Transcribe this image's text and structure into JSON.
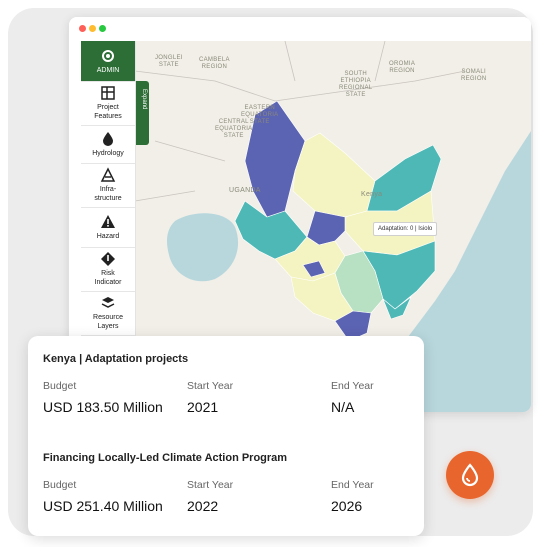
{
  "window_controls": {
    "close_color": "#ff5f57",
    "minimize_color": "#febc2e",
    "maximize_color": "#28c840"
  },
  "sidebar": {
    "items": [
      {
        "label": "ADMIN",
        "icon": "admin-gear-icon"
      },
      {
        "label": "Project\nFeatures",
        "icon": "project-features-icon"
      },
      {
        "label": "Hydrology",
        "icon": "droplet-icon"
      },
      {
        "label": "Infra-\nstructure",
        "icon": "infrastructure-icon"
      },
      {
        "label": "Hazard",
        "icon": "warning-icon"
      },
      {
        "label": "Risk\nIndicator",
        "icon": "risk-indicator-icon"
      },
      {
        "label": "Resource\nLayers",
        "icon": "resource-layers-icon"
      }
    ],
    "expand_label": "Expand"
  },
  "map": {
    "labels": [
      "JONGLEI\nSTATE",
      "CAMBELA\nREGION",
      "OROMIA\nREGION",
      "SOMALI\nREGION",
      "SOUTH\nETHIOPIA\nREGIONAL\nSTATE",
      "EASTERN\nEQUATORIA\nSTATE",
      "CENTRAL\nEQUATORIA\nSTATE",
      "UGANDA",
      "Kenya"
    ],
    "tooltip": "Adaptation: 0 | Isiolo",
    "colors": {
      "dark": "#5b63b3",
      "teal": "#4db8b6",
      "yellow": "#f4f4c2",
      "mint": "#b8e0c2",
      "water": "#b7d7dd"
    }
  },
  "card": {
    "project1": {
      "title": "Kenya | Adaptation projects",
      "budget_label": "Budget",
      "budget_value": "USD 183.50 Million",
      "start_label": "Start Year",
      "start_value": "2021",
      "end_label": "End Year",
      "end_value": "N/A"
    },
    "project2": {
      "title": "Financing Locally-Led Climate Action Program",
      "budget_label": "Budget",
      "budget_value": "USD 251.40 Million",
      "start_label": "Start Year",
      "start_value": "2022",
      "end_label": "End Year",
      "end_value": "2026"
    }
  },
  "fab": {
    "icon": "droplet-icon",
    "color": "#e8662d"
  }
}
